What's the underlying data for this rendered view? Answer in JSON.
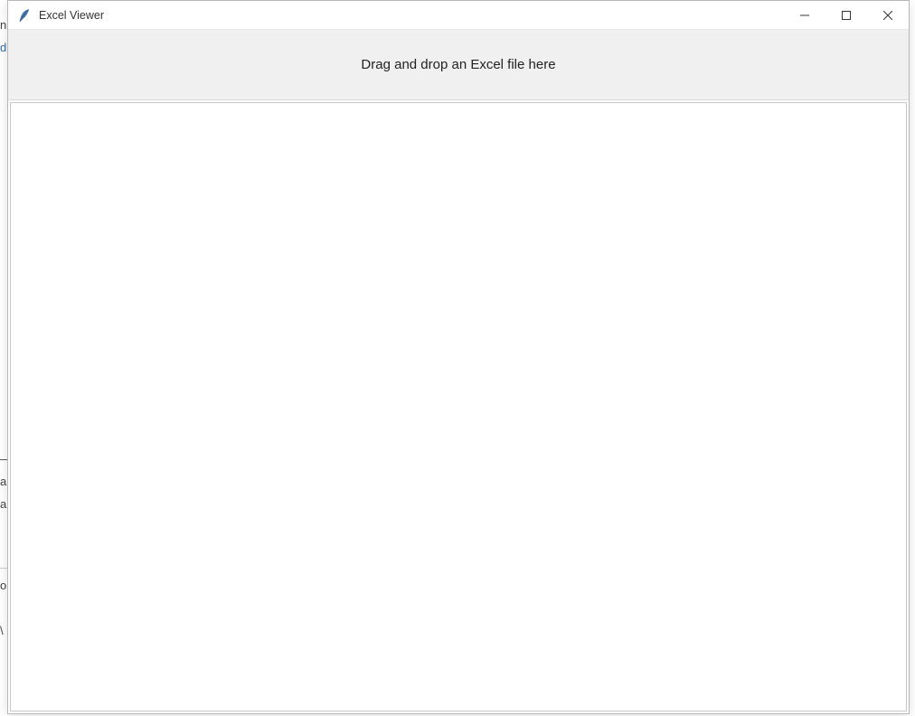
{
  "window": {
    "title": "Excel Viewer"
  },
  "drop_zone": {
    "label": "Drag and drop an Excel file here"
  },
  "background": {
    "frag1": "n",
    "frag2": "d",
    "frag3": "—",
    "frag4": "a",
    "frag5": "a",
    "frag6": "o",
    "frag7": "\\"
  }
}
